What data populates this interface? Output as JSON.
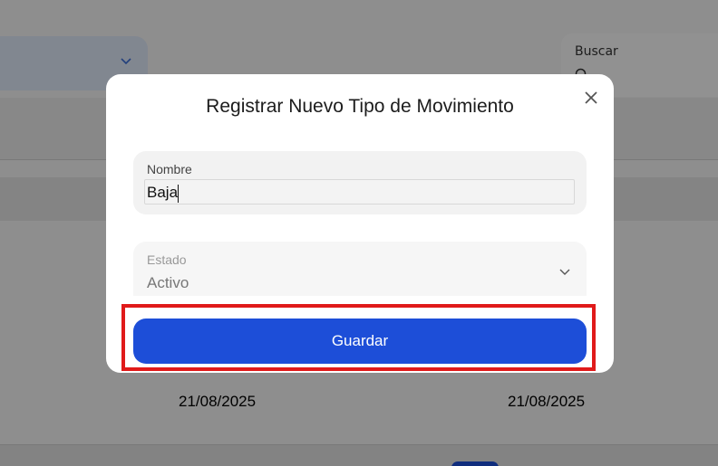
{
  "background": {
    "search_label": "Buscar",
    "row_dates": [
      "21/08/2025",
      "21/08/2025"
    ]
  },
  "modal": {
    "title": "Registrar Nuevo Tipo de Movimiento",
    "name_field": {
      "label": "Nombre",
      "value": "Baja"
    },
    "status_field": {
      "label": "Estado",
      "value": "Activo"
    },
    "save_label": "Guardar"
  },
  "colors": {
    "primary": "#1d4ed8",
    "highlight": "#e01a1a",
    "overlay": "rgba(0,0,0,0.42)"
  },
  "icons": [
    "chevron-down-icon",
    "search-icon",
    "close-icon"
  ]
}
